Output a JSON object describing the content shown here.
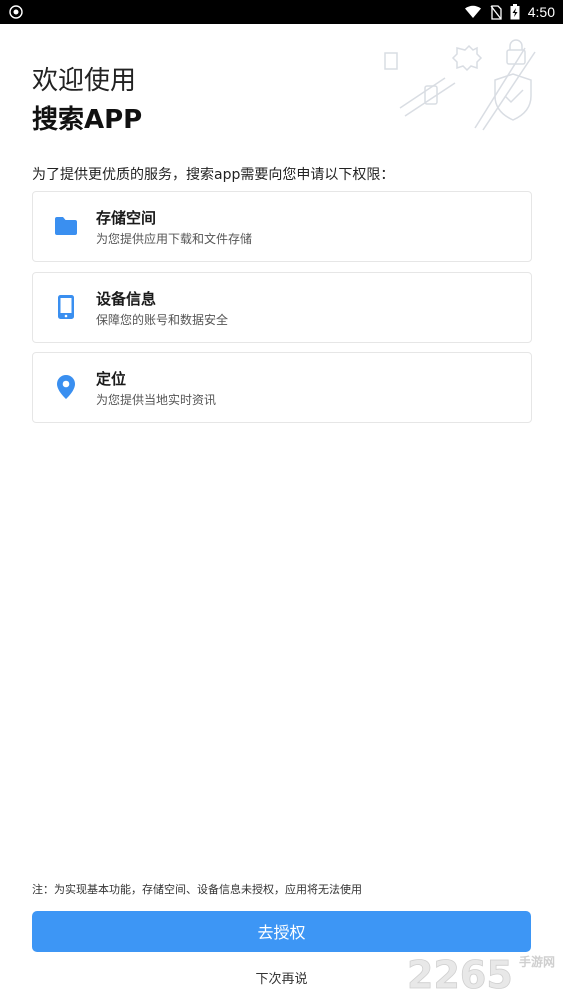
{
  "status_bar": {
    "time": "4:50"
  },
  "header": {
    "line1": "欢迎使用",
    "line2": "搜索APP"
  },
  "intro": "为了提供更优质的服务，搜索app需要向您申请以下权限：",
  "permissions": [
    {
      "name": "存储空间",
      "desc": "为您提供应用下载和文件存储",
      "icon": "folder-icon"
    },
    {
      "name": "设备信息",
      "desc": "保障您的账号和数据安全",
      "icon": "phone-icon"
    },
    {
      "name": "定位",
      "desc": "为您提供当地实时资讯",
      "icon": "location-pin-icon"
    }
  ],
  "note": "注：为实现基本功能，存储空间、设备信息未授权，应用将无法使用",
  "actions": {
    "authorize": "去授权",
    "later": "下次再说"
  },
  "watermark": {
    "number": "2265",
    "suffix": "手游网"
  },
  "colors": {
    "accent": "#3d96f5",
    "icon_blue": "#3a8ff0"
  }
}
